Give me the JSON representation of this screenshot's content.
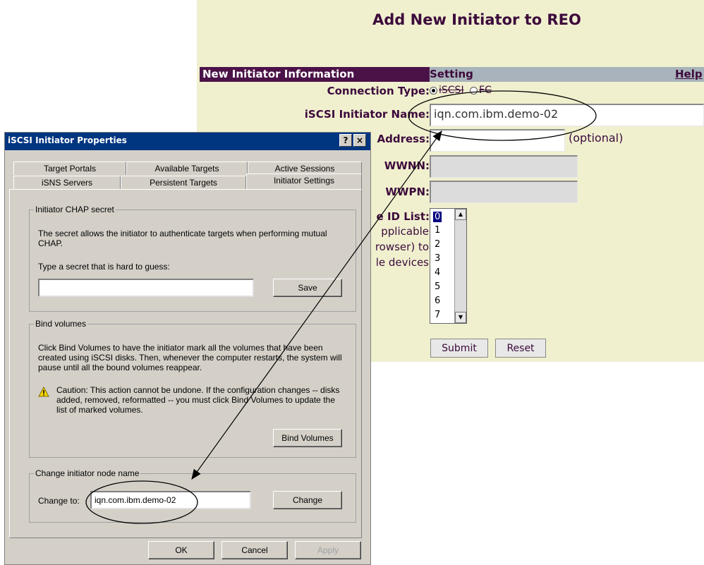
{
  "web": {
    "title": "Add New Initiator to REO",
    "header_left": "New Initiator Information",
    "header_setting": "Setting",
    "header_help": "Help",
    "connection_type_label": "Connection Type:",
    "radio_iscsi": "iSCSI",
    "radio_fc": "FC",
    "initiator_name_label": "iSCSI Initiator Name:",
    "initiator_name_value": "iqn.com.ibm.demo-02",
    "address_label": "Address:",
    "address_value": "",
    "optional": "(optional)",
    "wwnn_label": "WWNN:",
    "wwpn_label": "WWPN:",
    "device_id_label": "e ID List:",
    "help_line1": "pplicable",
    "help_line2": "rowser) to",
    "help_line3": "le devices",
    "device_ids": [
      "0",
      "1",
      "2",
      "3",
      "4",
      "5",
      "6",
      "7"
    ],
    "selected_device_id": "0",
    "submit": "Submit",
    "reset": "Reset"
  },
  "dialog": {
    "title": "iSCSI Initiator Properties",
    "help_btn": "?",
    "close_btn": "×",
    "tabs_row1": [
      "Target Portals",
      "Available Targets",
      "Active Sessions"
    ],
    "tabs_row2": [
      "iSNS Servers",
      "Persistent Targets",
      "Initiator Settings"
    ],
    "chap_group": "Initiator CHAP secret",
    "chap_desc": "The secret allows the initiator to authenticate targets when performing mutual CHAP.",
    "chap_prompt": "Type a secret that is hard to guess:",
    "chap_value": "",
    "save": "Save",
    "bind_group": "Bind volumes",
    "bind_desc": "Click Bind Volumes to have the initiator mark all the volumes that have been created using iSCSI disks. Then, whenever the computer restarts, the system will pause until all the bound volumes reappear.",
    "caution": "Caution: This action cannot be undone. If the configuration changes -- disks added, removed, reformatted -- you must click Bind Volumes to update the list of marked volumes.",
    "bind_button": "Bind Volumes",
    "node_group": "Change initiator node name",
    "change_to_label": "Change to:",
    "node_value": "iqn.com.ibm.demo-02",
    "change": "Change",
    "ok": "OK",
    "cancel": "Cancel",
    "apply": "Apply"
  },
  "colors": {
    "web_bg": "#f0f0cf",
    "web_accent": "#4b1248",
    "titlebar": "#003580",
    "dialog_bg": "#d4d0c8"
  }
}
